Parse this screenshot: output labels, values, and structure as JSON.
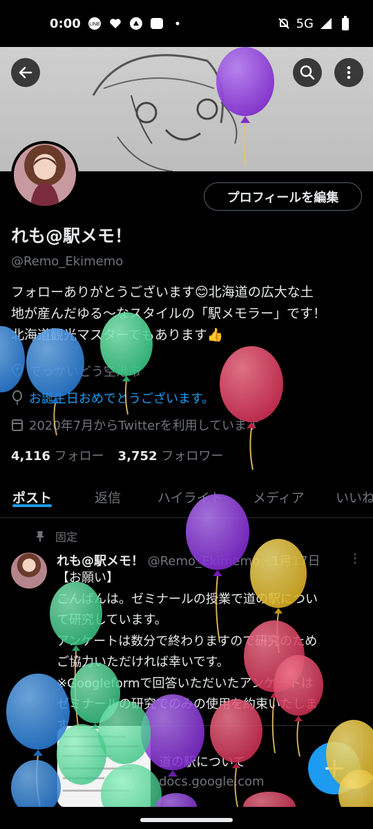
{
  "status_bar": {
    "time": "0:00",
    "icons_left": [
      "line-icon",
      "heart-icon",
      "app-icon",
      "line-manga-icon",
      "dot-icon"
    ],
    "network": "5G",
    "icons_right": [
      "mute-icon",
      "signal-icon",
      "battery-icon"
    ]
  },
  "header": {
    "back_icon": "back-arrow-icon",
    "search_icon": "search-icon",
    "more_icon": "more-vertical-icon"
  },
  "profile": {
    "edit_button": "プロフィールを編集",
    "name": "れも@駅メモ！",
    "handle": "@Remo_Ekimemo",
    "bio_lines": [
      "フォローありがとうございます😊北海道の広大な土",
      "地が産んだゆる〜なスタイルの「駅メモラー」です！",
      "北海道観光マスターでもあります👍"
    ],
    "location": "でっかいどう空港市",
    "birthday": "お誕生日おめでとうございます。",
    "joined": "2020年7月からTwitterを利用しています",
    "following_count": "4,116",
    "following_label": "フォロー",
    "followers_count": "3,752",
    "followers_label": "フォロワー"
  },
  "tabs": [
    "ポスト",
    "返信",
    "ハイライト",
    "メディア",
    "いいね"
  ],
  "active_tab": "ポスト",
  "pinned_post": {
    "pinned_label": "固定",
    "author_name": "れも@駅メモ！",
    "author_handle": "@Remo_Ekimemo",
    "date": "· 1月17日",
    "more": "⋮",
    "text_lines": [
      "【お願い】",
      "こんばんは。ゼミナールの授業で道の駅につい",
      "て研究しています。",
      "アンケートは数分で終わりますので研究のため",
      "ご協力いただければ幸いです。",
      "※Googleformで回答いただいたアンケートは",
      "ゼミナールの研究でのみの使用を約束いたしま",
      "す。"
    ],
    "card_title": "道の駅について",
    "card_domain": "docs.google.com"
  },
  "fab": {
    "label": "+"
  },
  "colors": {
    "background": "#000000",
    "text_primary": "#e7e9ea",
    "text_secondary": "#71767b",
    "accent": "#1d9bf0",
    "balloon_purple": "#8b2fd6",
    "balloon_red": "#d9385a",
    "balloon_green": "#3fcf8e",
    "balloon_blue": "#2f8ae0",
    "balloon_yellow": "#e8c02a"
  }
}
